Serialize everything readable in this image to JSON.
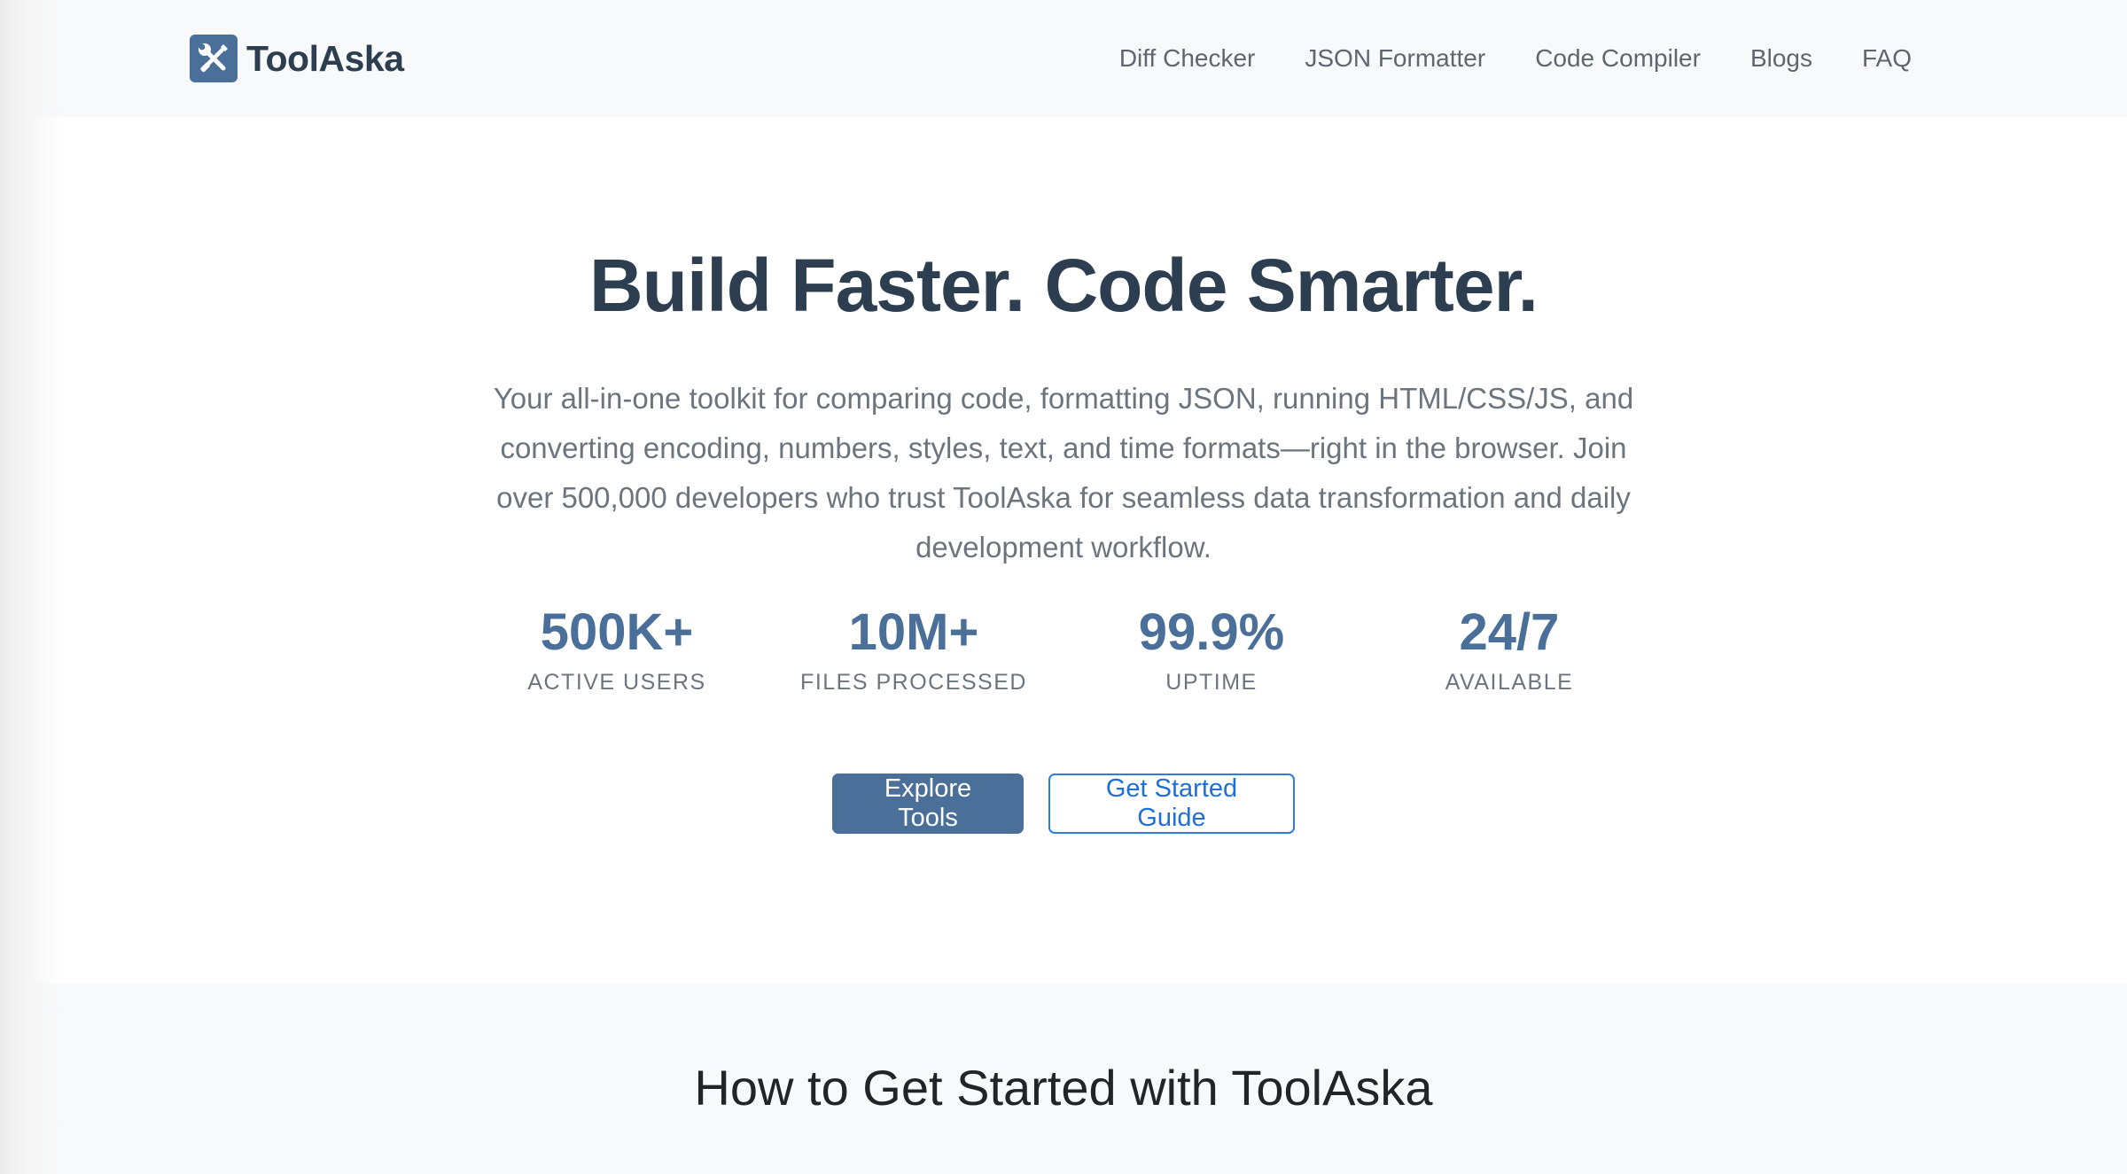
{
  "brand": {
    "name": "ToolAska",
    "logo_icon": "tools-icon",
    "logo_color": "#4a6f99"
  },
  "nav": {
    "items": [
      {
        "label": "Diff Checker"
      },
      {
        "label": "JSON Formatter"
      },
      {
        "label": "Code Compiler"
      },
      {
        "label": "Blogs"
      },
      {
        "label": "FAQ"
      }
    ]
  },
  "hero": {
    "title": "Build Faster. Code Smarter.",
    "description": "Your all-in-one toolkit for comparing code, formatting JSON, running HTML/CSS/JS, and converting encoding, numbers, styles, text, and time formats—right in the browser. Join over 500,000 developers who trust ToolAska for seamless data transformation and daily development workflow.",
    "stats": [
      {
        "value": "500K+",
        "label": "ACTIVE USERS"
      },
      {
        "value": "10M+",
        "label": "FILES PROCESSED"
      },
      {
        "value": "99.9%",
        "label": "UPTIME"
      },
      {
        "value": "24/7",
        "label": "AVAILABLE"
      }
    ],
    "primary_button": "Explore Tools",
    "secondary_button": "Get Started Guide"
  },
  "steps": {
    "title": "How to Get Started with ToolAska"
  },
  "colors": {
    "accent": "#4a6f99",
    "heading": "#2c3e50",
    "muted": "#6c757d",
    "link_blue": "#1f6fd6",
    "section_bg": "#f8f9fa"
  }
}
